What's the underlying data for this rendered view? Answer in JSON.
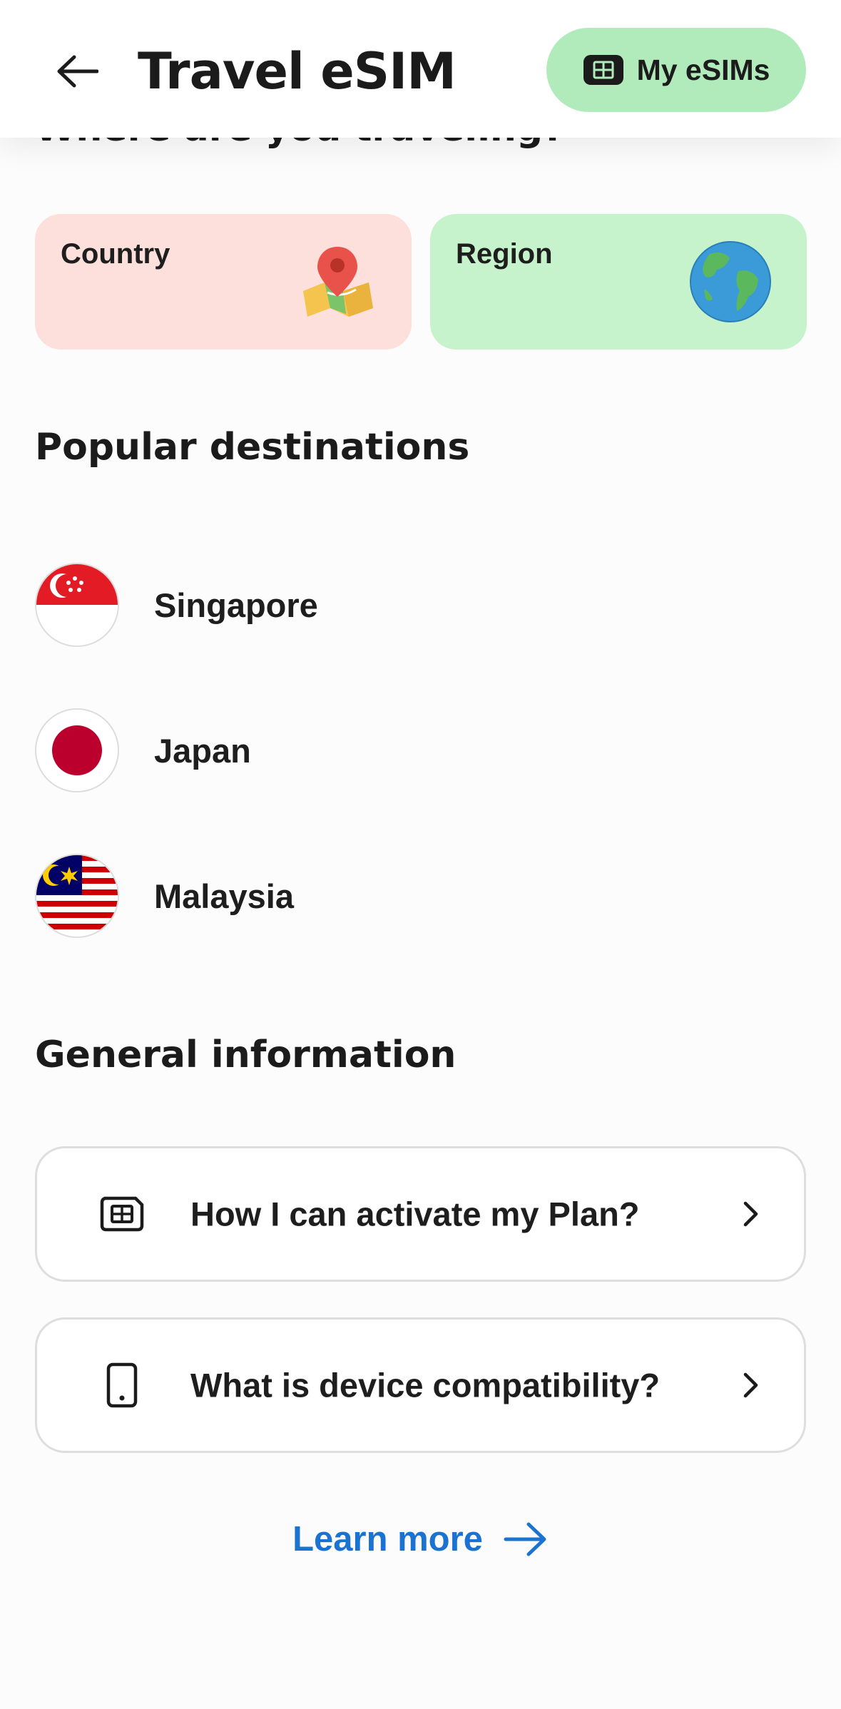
{
  "header": {
    "title": "Travel eSIM",
    "back_icon": "arrow-left-icon",
    "my_esims_label": "My eSIMs",
    "my_esims_icon": "sim-card-icon"
  },
  "partial_heading": "Where are you traveling?",
  "categories": [
    {
      "label": "Country",
      "icon": "map-pin-icon",
      "color": "#fde0db"
    },
    {
      "label": "Region",
      "icon": "globe-icon",
      "color": "#c6f2cc"
    }
  ],
  "popular": {
    "title": "Popular destinations",
    "items": [
      {
        "name": "Singapore",
        "flag": "singapore-flag-icon"
      },
      {
        "name": "Japan",
        "flag": "japan-flag-icon"
      },
      {
        "name": "Malaysia",
        "flag": "malaysia-flag-icon"
      }
    ]
  },
  "general": {
    "title": "General information",
    "items": [
      {
        "label": "How I can activate my Plan?",
        "icon": "sim-card-icon"
      },
      {
        "label": "What is device compatibility?",
        "icon": "smartphone-icon"
      }
    ]
  },
  "learn_more": "Learn more",
  "colors": {
    "accent_green": "#b1ebbb",
    "link_blue": "#1a73d1"
  }
}
